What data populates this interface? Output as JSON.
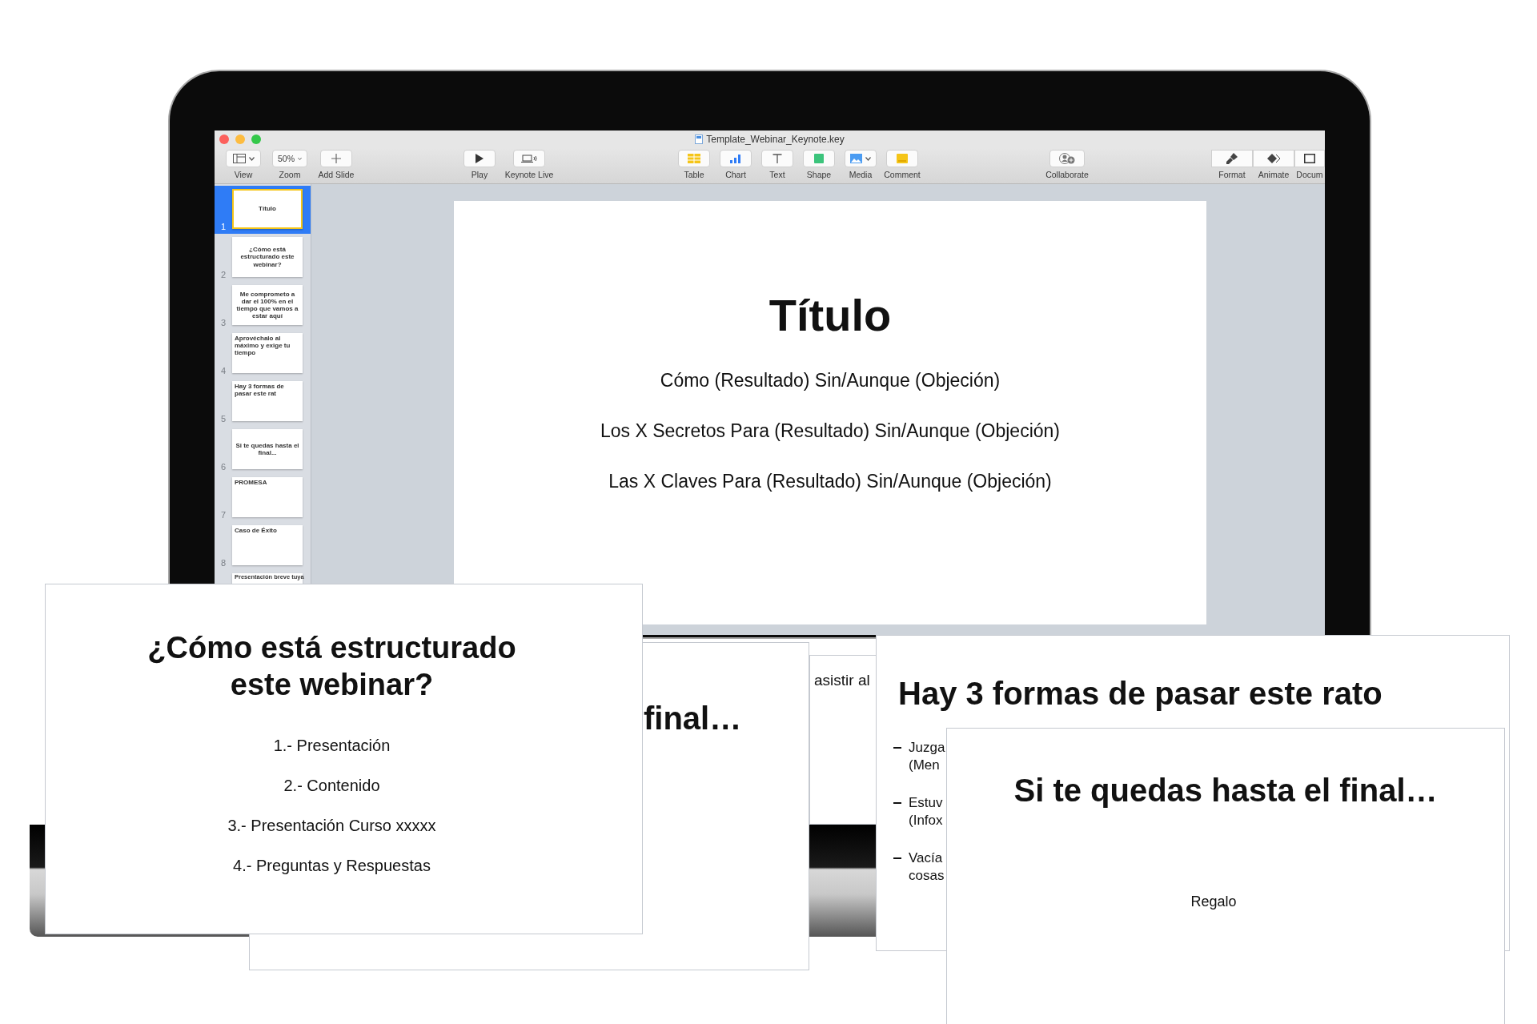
{
  "window": {
    "title": "Template_Webinar_Keynote.key"
  },
  "toolbar_groups": [
    [
      {
        "kind": "view",
        "label": "View"
      },
      {
        "kind": "zoom",
        "label": "Zoom",
        "value": "50%"
      },
      {
        "kind": "add",
        "label": "Add Slide"
      }
    ],
    [
      {
        "kind": "play",
        "label": "Play"
      },
      {
        "kind": "live",
        "label": "Keynote Live"
      }
    ],
    [
      {
        "kind": "table",
        "label": "Table"
      },
      {
        "kind": "chart",
        "label": "Chart"
      },
      {
        "kind": "text",
        "label": "Text"
      },
      {
        "kind": "shape",
        "label": "Shape"
      },
      {
        "kind": "media",
        "label": "Media"
      },
      {
        "kind": "comment",
        "label": "Comment"
      }
    ],
    [
      {
        "kind": "collaborate",
        "label": "Collaborate"
      }
    ],
    [
      {
        "kind": "format",
        "label": "Format"
      },
      {
        "kind": "animate",
        "label": "Animate"
      },
      {
        "kind": "document",
        "label": "Docum"
      }
    ]
  ],
  "slide_navigator": [
    {
      "number": "1",
      "selected": true,
      "title": "Título"
    },
    {
      "number": "2",
      "selected": false,
      "title": "¿Cómo está estructurado este webinar?"
    },
    {
      "number": "3",
      "selected": false,
      "title": "Me comprometo a dar el 100% en el tiempo que vamos a estar aquí"
    },
    {
      "number": "4",
      "selected": false,
      "title": "Aprovéchalo al máximo y exige tu tiempo"
    },
    {
      "number": "5",
      "selected": false,
      "title": "Hay 3 formas de pasar este rat"
    },
    {
      "number": "6",
      "selected": false,
      "title": "Si te quedas hasta el final..."
    },
    {
      "number": "7",
      "selected": false,
      "title": "PROMESA"
    },
    {
      "number": "8",
      "selected": false,
      "title": "Caso de Éxito"
    },
    {
      "title": "Presentación breve tuya"
    }
  ],
  "current_slide": {
    "title": "Título",
    "lines": [
      "Cómo (Resultado) Sin/Aunque (Objeción)",
      "Los X Secretos Para (Resultado) Sin/Aunque (Objeción)",
      "Las X Claves Para (Resultado) Sin/Aunque (Objeción)"
    ]
  },
  "overlay_slides": [
    {
      "kind": "fragment",
      "text": "final…"
    },
    {
      "kind": "fragment",
      "text": "asistir al"
    },
    {
      "kind": "agenda",
      "title": "¿Cómo está estructurado este webinar?",
      "items": [
        "1.- Presentación",
        "2.- Contenido",
        "3.- Presentación Curso xxxxx",
        "4.- Preguntas y Respuestas"
      ]
    },
    {
      "kind": "bullets",
      "title": "Hay 3 formas de pasar este rato",
      "bullets": [
        [
          "Juzga",
          "(Men"
        ],
        [
          "Estuv",
          "(Infox"
        ],
        [
          "Vacía",
          "cosas"
        ]
      ]
    },
    {
      "kind": "centered",
      "title": "Si te quedas hasta el final…",
      "subtitle": "Regalo"
    }
  ]
}
